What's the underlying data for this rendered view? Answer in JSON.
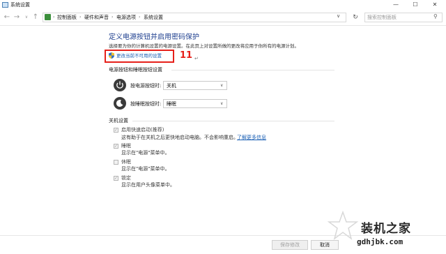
{
  "window": {
    "title": "系统设置",
    "min_glyph": "—",
    "max_glyph": "☐",
    "close_glyph": "✕"
  },
  "nav": {
    "back_glyph": "←",
    "forward_glyph": "→",
    "down_glyph": "∨",
    "up_glyph": "↑",
    "breadcrumbs": [
      "控制面板",
      "硬件和声音",
      "电源选项",
      "系统设置"
    ],
    "separator": "›",
    "dropdown_glyph": "∨",
    "refresh_glyph": "↻",
    "search_placeholder": "搜索控制面板",
    "search_glyph": "⚲"
  },
  "main": {
    "title": "定义电源按钮并启用密码保护",
    "description": "选择要为你的计算机设置的电源设置。在此页上对设置所做的更改将应用于你所有的电源计划。",
    "change_link": "更改当前不可用的设置",
    "annotation_number": "11",
    "annotation_mark": "↵"
  },
  "power_buttons": {
    "section_title": "电源按钮和睡眠按钮设置",
    "power_label": "按电源按钮时:",
    "power_value": "关机",
    "sleep_label": "按睡眠按钮时:",
    "sleep_value": "睡眠",
    "arrow_glyph": "∨"
  },
  "shutdown": {
    "section_title": "关机设置",
    "items": [
      {
        "label": "启用快速启动(推荐)",
        "desc": "这有助于在关机之后更快地启动电脑。不会影响重启。",
        "link": "了解更多信息",
        "checked": true
      },
      {
        "label": "睡眠",
        "desc": "显示在\"电源\"菜单中。",
        "checked": true
      },
      {
        "label": "休眠",
        "desc": "显示在\"电源\"菜单中。",
        "checked": false
      },
      {
        "label": "锁定",
        "desc": "显示在用户头像菜单中。",
        "checked": true
      }
    ],
    "check_glyph": "✓"
  },
  "footer": {
    "save_label": "保存修改",
    "cancel_label": "取消"
  },
  "watermark": {
    "brand": "装机之家",
    "url": "gdhjbk.com"
  },
  "colors": {
    "accent_link": "#1a5fb4",
    "title_blue": "#1e3f8f",
    "annotation_red": "#e6201a"
  }
}
